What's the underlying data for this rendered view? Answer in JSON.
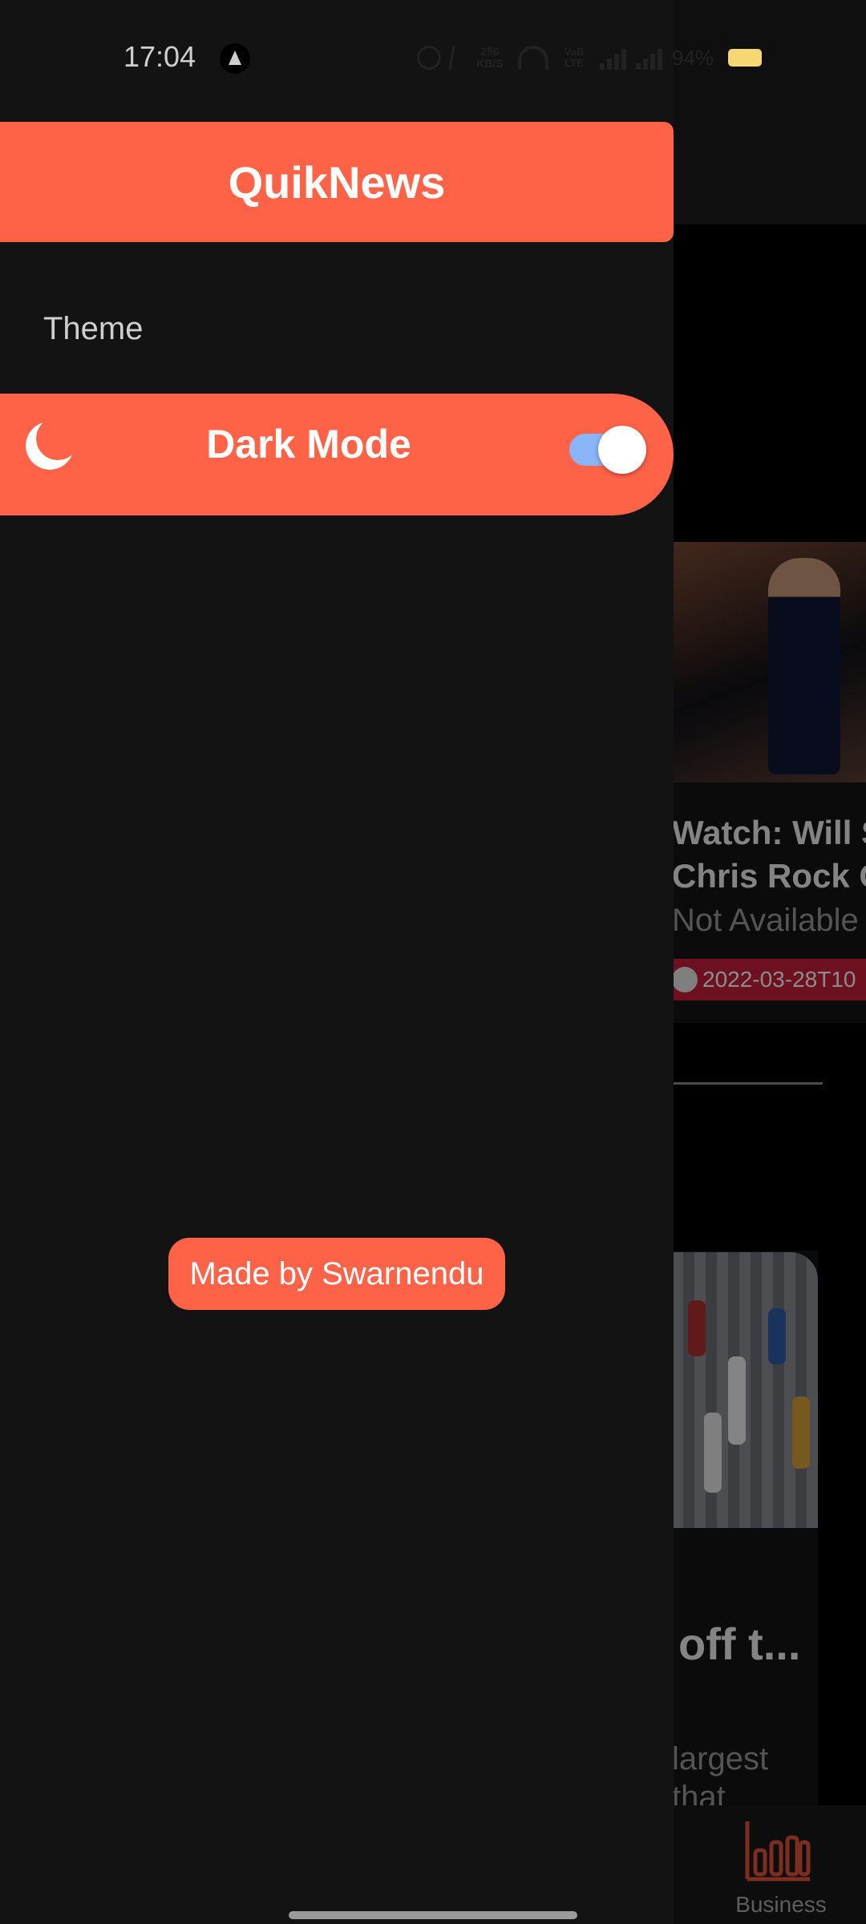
{
  "status_bar": {
    "time": "17:04",
    "speed": "256 KB/S",
    "volte": "VoB LTE",
    "battery_text": "94%"
  },
  "drawer": {
    "app_title": "QuikNews",
    "section_label": "Theme",
    "dark_mode": {
      "label": "Dark Mode",
      "icon": "moon-icon",
      "enabled": true
    },
    "credit": "Made by Swarnendu"
  },
  "background": {
    "article1": {
      "title_lines": [
        "Watch: Will Sm",
        "Chris Rock Ov"
      ],
      "source": "Not Available",
      "date": "2022-03-28T10"
    },
    "article2": {
      "title": "off t...",
      "description": "largest that"
    },
    "bottom_nav": {
      "active_label": "Business",
      "active_icon": "bar-chart-icon"
    }
  },
  "colors": {
    "accent": "#ff6347",
    "drawer_bg": "#131313",
    "toggle_track": "#8ab4f8",
    "date_badge": "#c7203d"
  }
}
